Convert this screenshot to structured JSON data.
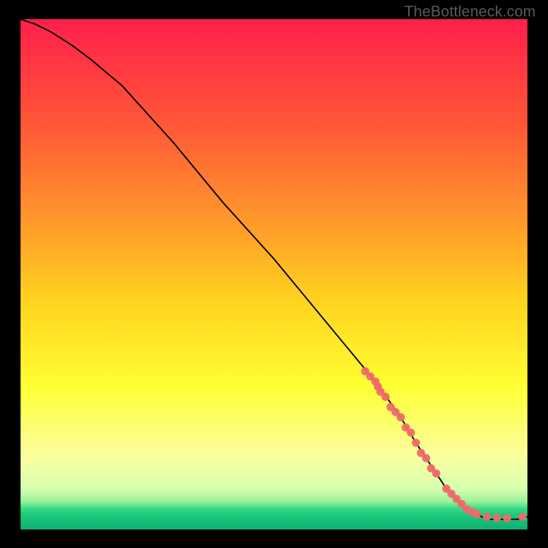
{
  "watermark": "TheBottleneck.com",
  "chart_data": {
    "type": "line",
    "title": "",
    "xlabel": "",
    "ylabel": "",
    "xlim": [
      0,
      100
    ],
    "ylim": [
      0,
      100
    ],
    "grid": false,
    "legend": false,
    "gradient_stops": [
      {
        "offset": 0.0,
        "color": "#ff1f4b"
      },
      {
        "offset": 0.2,
        "color": "#ff5538"
      },
      {
        "offset": 0.4,
        "color": "#ff9a2a"
      },
      {
        "offset": 0.55,
        "color": "#ffd21f"
      },
      {
        "offset": 0.72,
        "color": "#ffff33"
      },
      {
        "offset": 0.86,
        "color": "#faffa0"
      },
      {
        "offset": 0.92,
        "color": "#d6ffb0"
      },
      {
        "offset": 0.945,
        "color": "#9af29a"
      },
      {
        "offset": 0.96,
        "color": "#32d884"
      },
      {
        "offset": 0.975,
        "color": "#18c47a"
      },
      {
        "offset": 1.0,
        "color": "#0fb071"
      }
    ],
    "series": [
      {
        "name": "bottleneck-curve",
        "type": "line",
        "color": "#000000",
        "x": [
          0,
          3,
          6,
          10,
          14,
          20,
          30,
          40,
          50,
          60,
          70,
          75,
          78,
          80,
          82,
          84,
          86,
          88,
          90,
          92,
          95,
          98,
          100
        ],
        "y": [
          100,
          99,
          97.5,
          95,
          92,
          87,
          76,
          64,
          53,
          41,
          29,
          22,
          17,
          14,
          11,
          8,
          6,
          4,
          3,
          2,
          2,
          2,
          2.5
        ]
      },
      {
        "name": "measurements",
        "type": "scatter",
        "color": "#ef6b6b",
        "radius": 6,
        "x": [
          68,
          69,
          70,
          70.5,
          71,
          72,
          73,
          74,
          75,
          76,
          77,
          78,
          79,
          80,
          81,
          82,
          84,
          85,
          86,
          87,
          88,
          89,
          90,
          92,
          94,
          96,
          99
        ],
        "y": [
          31,
          30,
          29,
          28,
          27,
          26,
          24,
          23,
          22,
          20,
          19,
          17,
          15,
          14,
          12,
          11,
          8,
          7,
          6,
          5,
          4,
          3.5,
          3,
          2.5,
          2.3,
          2.2,
          2.5
        ]
      }
    ]
  }
}
